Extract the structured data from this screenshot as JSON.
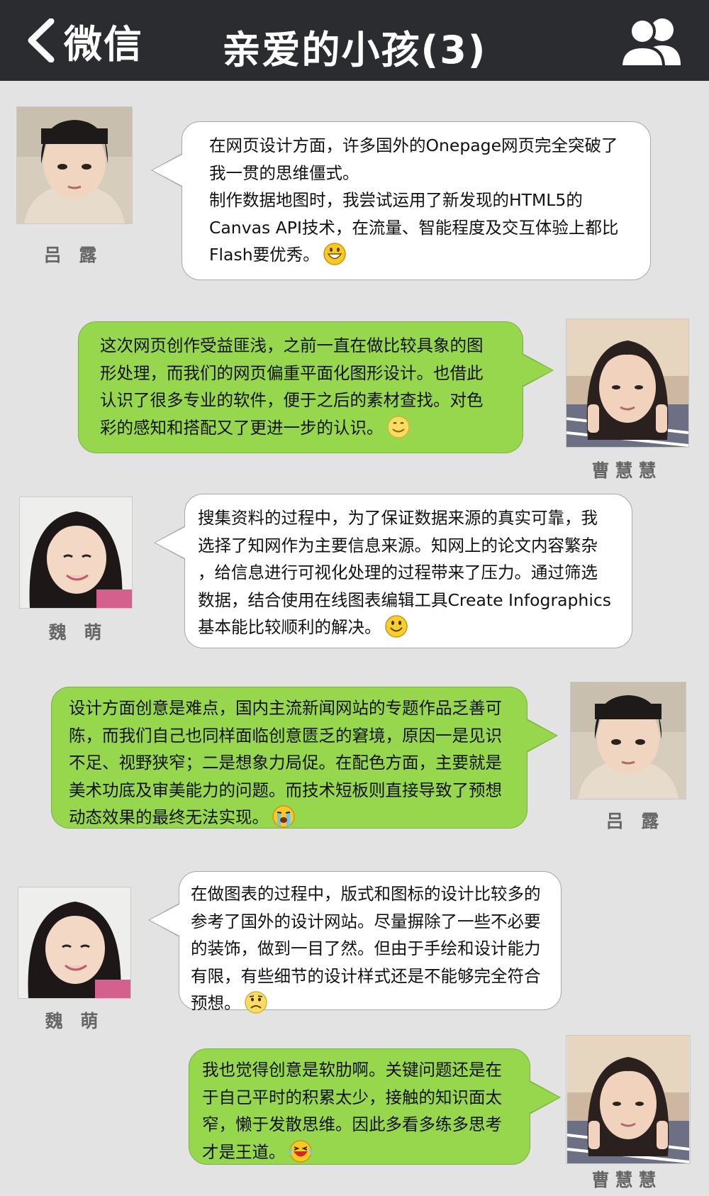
{
  "header": {
    "back_label": "微信",
    "title": "亲爱的小孩(3)",
    "back_icon": "chevron-left-icon",
    "members_icon": "group-members-icon"
  },
  "messages": [
    {
      "sender": "吕 露",
      "side": "left",
      "bubble": "white",
      "text": "在网页设计方面，许多国外的Onepage网页完全突破了\n我一贯的思维僵式。\n制作数据地图时，我尝试运用了新发现的HTML5的\nCanvas API技术，在流量、智能程度及交互体验上都比\nFlash要优秀。",
      "emoji": "grin-emoji"
    },
    {
      "sender": "曹慧慧",
      "side": "right",
      "bubble": "green",
      "text": "这次网页创作受益匪浅，之前一直在做比较具象的图\n形处理，而我们的网页偏重平面化图形设计。也借此\n认识了很多专业的软件，便于之后的素材查找。对色\n彩的感知和搭配又了更进一步的认识。",
      "emoji": "smile-emoji"
    },
    {
      "sender": "魏 萌",
      "side": "left",
      "bubble": "white",
      "text": "搜集资料的过程中，为了保证数据来源的真实可靠，我\n选择了知网作为主要信息来源。知网上的论文内容繁杂\n，给信息进行可视化处理的过程带来了压力。通过筛选\n数据，结合使用在线图表编辑工具Create Infographics\n基本能比较顺利的解决。",
      "emoji": "happy-emoji"
    },
    {
      "sender": "吕 露",
      "side": "right",
      "bubble": "green",
      "text": "设计方面创意是难点，国内主流新闻网站的专题作品乏善可\n陈，而我们自己也同样面临创意匮乏的窘境，原因一是见识\n不足、视野狭窄；二是想象力局促。在配色方面，主要就是\n美术功底及审美能力的问题。而技术短板则直接导致了预想\n动态效果的最终无法实现。",
      "emoji": "crying-emoji"
    },
    {
      "sender": "魏 萌",
      "side": "left",
      "bubble": "white",
      "text": "在做图表的过程中，版式和图标的设计比较多的\n参考了国外的设计网站。尽量摒除了一些不必要\n的装饰，做到一目了然。但由于手绘和设计能力\n有限，有些细节的设计样式还是不能够完全符合\n预想。",
      "emoji": "sad-emoji"
    },
    {
      "sender": "曹慧慧",
      "side": "right",
      "bubble": "green",
      "text": "我也觉得创意是软肋啊。关键问题还是在\n于自己平时的积累太少，接触的知识面太\n窄，懒于发散思维。因此多看多练多思考\n才是王道。",
      "emoji": "laughing-tears-emoji"
    }
  ]
}
